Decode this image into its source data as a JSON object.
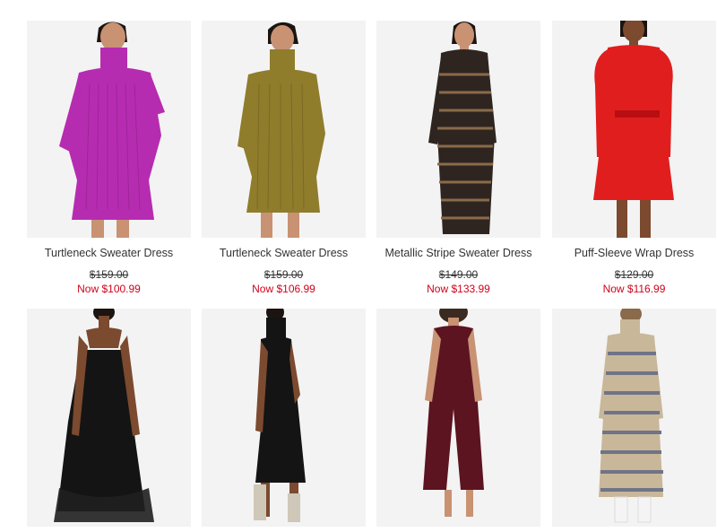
{
  "products": [
    {
      "title": "Turtleneck Sweater Dress",
      "original_price": "$159.00",
      "sale_price": "Now $100.99",
      "color": "#b62cb0"
    },
    {
      "title": "Turtleneck Sweater Dress",
      "original_price": "$159.00",
      "sale_price": "Now $106.99",
      "color": "#8f7d2c"
    },
    {
      "title": "Metallic Stripe Sweater Dress",
      "original_price": "$149.00",
      "sale_price": "Now $133.99",
      "color": "#2e2520"
    },
    {
      "title": "Puff-Sleeve Wrap Dress",
      "original_price": "$129.00",
      "sale_price": "Now $116.99",
      "color": "#e01e1e"
    },
    {
      "color": "#141414"
    },
    {
      "color": "#141414"
    },
    {
      "color": "#5c1420"
    },
    {
      "color": "#c9b79a"
    }
  ]
}
